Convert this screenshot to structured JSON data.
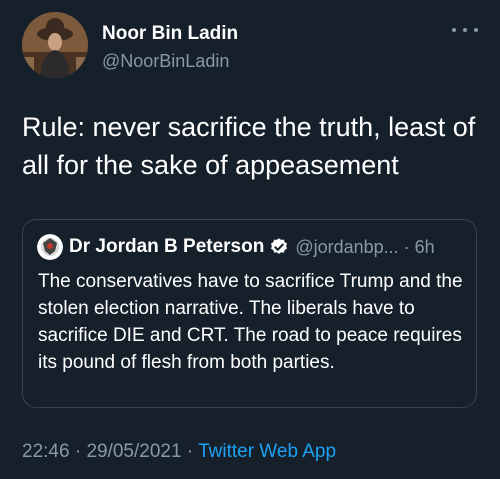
{
  "tweet": {
    "author": {
      "display_name": "Noor Bin Ladin",
      "handle": "@NoorBinLadin"
    },
    "text": "Rule: never sacrifice the truth, least of all for the sake of appeasement",
    "more_icon": "more-horizontal-icon"
  },
  "quoted_tweet": {
    "author": {
      "display_name": "Dr Jordan B Peterson",
      "handle": "@jordanbp...",
      "verified_icon": "verified-badge-icon"
    },
    "separator": "·",
    "time": "6h",
    "text": "The conservatives have to sacrifice Trump and the stolen election narrative. The liberals have to sacrifice DIE and CRT. The road to peace requires its pound of flesh from both parties."
  },
  "meta": {
    "time": "22:46",
    "separator1": " · ",
    "date": "29/05/2021",
    "separator2": " · ",
    "source": "Twitter Web App"
  },
  "colors": {
    "background": "#15202b",
    "text": "#ffffff",
    "secondary": "#8899a6",
    "accent": "#1da1f2",
    "border": "#38444d"
  }
}
